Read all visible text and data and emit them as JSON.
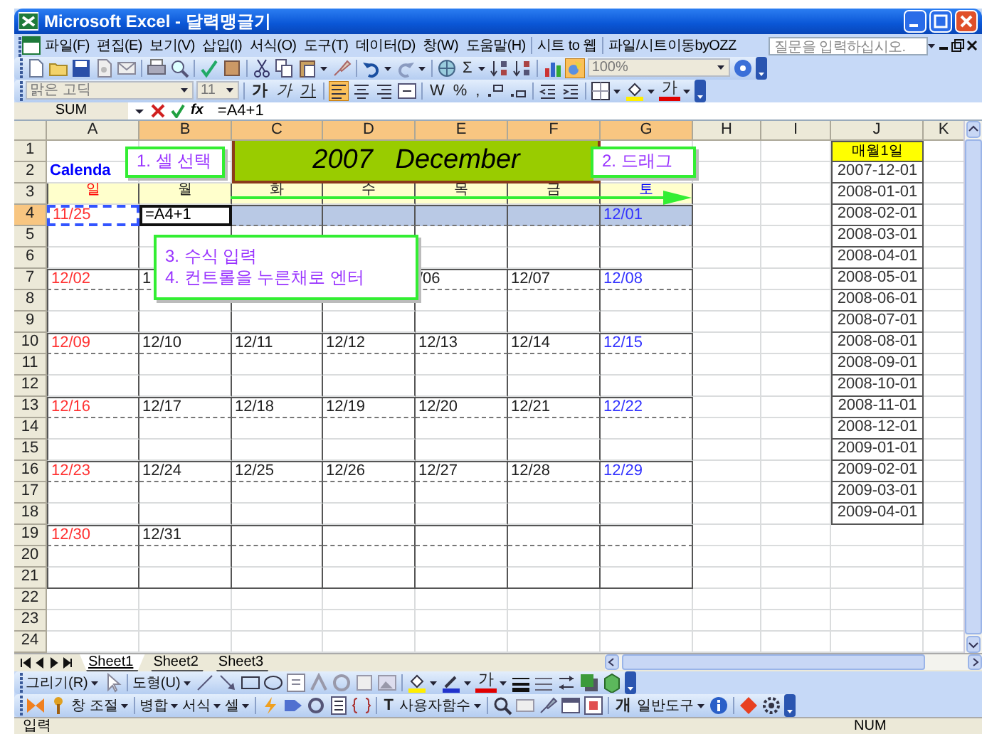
{
  "window": {
    "title": "Microsoft Excel - 달력맹글기"
  },
  "menu": {
    "items": [
      "파일(F)",
      "편집(E)",
      "보기(V)",
      "삽입(I)",
      "서식(O)",
      "도구(T)",
      "데이터(D)",
      "창(W)",
      "도움말(H)"
    ],
    "extras": [
      "시트 to 웹",
      "파일/시트이동byOZZ"
    ],
    "help_placeholder": "질문을 입력하십시오."
  },
  "toolbars": {
    "standard": {
      "sum": "Σ",
      "zoom": "100%"
    },
    "formatting": {
      "font": "맑은 고딕",
      "size": "11",
      "bold": "가",
      "italic": "가",
      "underline": "가",
      "currency": "W",
      "percent": "%",
      "comma": ",",
      "font_color": "가"
    },
    "drawing": {
      "draw_menu": "그리기(R)",
      "shapes_menu": "도형(U)",
      "font_color": "가"
    },
    "custom": {
      "window_menu": "창 조절",
      "merge_menu": "병합",
      "format_menu": "서식",
      "cell_menu": "셀",
      "text_glyph": "T",
      "function_menu": "사용자함수",
      "tool_glyph": "개",
      "tools_menu": "일반도구"
    }
  },
  "formula_bar": {
    "name_box": "SUM",
    "insert_function": "fx",
    "formula": "=A4+1"
  },
  "columns": [
    {
      "label": "A",
      "selected": false
    },
    {
      "label": "B",
      "selected": true
    },
    {
      "label": "C",
      "selected": true
    },
    {
      "label": "D",
      "selected": true
    },
    {
      "label": "E",
      "selected": true
    },
    {
      "label": "F",
      "selected": true
    },
    {
      "label": "G",
      "selected": true
    },
    {
      "label": "H",
      "selected": false
    },
    {
      "label": "I",
      "selected": false
    },
    {
      "label": "J",
      "selected": false
    },
    {
      "label": "K",
      "selected": false
    }
  ],
  "rows": [
    {
      "label": "1",
      "selected": false,
      "cells": {
        "C": {
          "text": "2007   December",
          "kind": "banner"
        },
        "J": {
          "text": "매월1일",
          "kind": "list-header"
        }
      }
    },
    {
      "label": "2",
      "selected": false,
      "cells": {
        "A": {
          "text": "Calenda",
          "kind": "label",
          "color": "#0000ff"
        },
        "J": {
          "text": "2007-12-01",
          "kind": "list"
        }
      }
    },
    {
      "label": "3",
      "selected": false,
      "cells": {
        "A": {
          "text": "일",
          "kind": "weekday",
          "color": "#ff0000"
        },
        "B": {
          "text": "월",
          "kind": "weekday",
          "color": "#222222"
        },
        "C": {
          "text": "화",
          "kind": "weekday",
          "color": "#222222"
        },
        "D": {
          "text": "수",
          "kind": "weekday",
          "color": "#222222"
        },
        "E": {
          "text": "목",
          "kind": "weekday",
          "color": "#222222"
        },
        "F": {
          "text": "금",
          "kind": "weekday",
          "color": "#222222"
        },
        "G": {
          "text": "토",
          "kind": "weekday",
          "color": "#0000ff"
        },
        "J": {
          "text": "2008-01-01",
          "kind": "list"
        }
      }
    },
    {
      "label": "4",
      "selected": true,
      "cells": {
        "A": {
          "text": "11/25",
          "kind": "referenced",
          "color": "#ff3333"
        },
        "B": {
          "text": "=A4+1",
          "kind": "editing"
        },
        "G": {
          "text": "12/01",
          "kind": "date",
          "color": "#3333ff"
        },
        "J": {
          "text": "2008-02-01",
          "kind": "list"
        }
      }
    },
    {
      "label": "5",
      "selected": false,
      "cells": {
        "J": {
          "text": "2008-03-01",
          "kind": "list"
        }
      }
    },
    {
      "label": "6",
      "selected": false,
      "cells": {
        "J": {
          "text": "2008-04-01",
          "kind": "list"
        }
      }
    },
    {
      "label": "7",
      "selected": false,
      "cells": {
        "A": {
          "text": "12/02",
          "kind": "date",
          "color": "#ff3333"
        },
        "B": {
          "text": "1",
          "kind": "date",
          "color": "#222222"
        },
        "E": {
          "text": "/06",
          "kind": "date",
          "color": "#222222"
        },
        "F": {
          "text": "12/07",
          "kind": "date",
          "color": "#222222"
        },
        "G": {
          "text": "12/08",
          "kind": "date",
          "color": "#3333ff"
        },
        "J": {
          "text": "2008-05-01",
          "kind": "list"
        }
      }
    },
    {
      "label": "8",
      "selected": false,
      "cells": {
        "J": {
          "text": "2008-06-01",
          "kind": "list"
        }
      }
    },
    {
      "label": "9",
      "selected": false,
      "cells": {
        "J": {
          "text": "2008-07-01",
          "kind": "list"
        }
      }
    },
    {
      "label": "10",
      "selected": false,
      "cells": {
        "A": {
          "text": "12/09",
          "kind": "date",
          "color": "#ff3333"
        },
        "B": {
          "text": "12/10",
          "kind": "date",
          "color": "#222222"
        },
        "C": {
          "text": "12/11",
          "kind": "date",
          "color": "#222222"
        },
        "D": {
          "text": "12/12",
          "kind": "date",
          "color": "#222222"
        },
        "E": {
          "text": "12/13",
          "kind": "date",
          "color": "#222222"
        },
        "F": {
          "text": "12/14",
          "kind": "date",
          "color": "#222222"
        },
        "G": {
          "text": "12/15",
          "kind": "date",
          "color": "#3333ff"
        },
        "J": {
          "text": "2008-08-01",
          "kind": "list"
        }
      }
    },
    {
      "label": "11",
      "selected": false,
      "cells": {
        "J": {
          "text": "2008-09-01",
          "kind": "list"
        }
      }
    },
    {
      "label": "12",
      "selected": false,
      "cells": {
        "J": {
          "text": "2008-10-01",
          "kind": "list"
        }
      }
    },
    {
      "label": "13",
      "selected": false,
      "cells": {
        "A": {
          "text": "12/16",
          "kind": "date",
          "color": "#ff3333"
        },
        "B": {
          "text": "12/17",
          "kind": "date",
          "color": "#222222"
        },
        "C": {
          "text": "12/18",
          "kind": "date",
          "color": "#222222"
        },
        "D": {
          "text": "12/19",
          "kind": "date",
          "color": "#222222"
        },
        "E": {
          "text": "12/20",
          "kind": "date",
          "color": "#222222"
        },
        "F": {
          "text": "12/21",
          "kind": "date",
          "color": "#222222"
        },
        "G": {
          "text": "12/22",
          "kind": "date",
          "color": "#3333ff"
        },
        "J": {
          "text": "2008-11-01",
          "kind": "list"
        }
      }
    },
    {
      "label": "14",
      "selected": false,
      "cells": {
        "J": {
          "text": "2008-12-01",
          "kind": "list"
        }
      }
    },
    {
      "label": "15",
      "selected": false,
      "cells": {
        "J": {
          "text": "2009-01-01",
          "kind": "list"
        }
      }
    },
    {
      "label": "16",
      "selected": false,
      "cells": {
        "A": {
          "text": "12/23",
          "kind": "date",
          "color": "#ff3333"
        },
        "B": {
          "text": "12/24",
          "kind": "date",
          "color": "#222222"
        },
        "C": {
          "text": "12/25",
          "kind": "date",
          "color": "#222222"
        },
        "D": {
          "text": "12/26",
          "kind": "date",
          "color": "#222222"
        },
        "E": {
          "text": "12/27",
          "kind": "date",
          "color": "#222222"
        },
        "F": {
          "text": "12/28",
          "kind": "date",
          "color": "#222222"
        },
        "G": {
          "text": "12/29",
          "kind": "date",
          "color": "#3333ff"
        },
        "J": {
          "text": "2009-02-01",
          "kind": "list"
        }
      }
    },
    {
      "label": "17",
      "selected": false,
      "cells": {
        "J": {
          "text": "2009-03-01",
          "kind": "list"
        }
      }
    },
    {
      "label": "18",
      "selected": false,
      "cells": {
        "J": {
          "text": "2009-04-01",
          "kind": "list"
        }
      }
    },
    {
      "label": "19",
      "selected": false,
      "cells": {
        "A": {
          "text": "12/30",
          "kind": "date",
          "color": "#ff3333"
        },
        "B": {
          "text": "12/31",
          "kind": "date",
          "color": "#222222"
        }
      }
    },
    {
      "label": "20",
      "selected": false,
      "cells": {}
    },
    {
      "label": "21",
      "selected": false,
      "cells": {}
    },
    {
      "label": "22",
      "selected": false,
      "cells": {}
    },
    {
      "label": "23",
      "selected": false,
      "cells": {}
    },
    {
      "label": "24",
      "selected": false,
      "cells": {}
    }
  ],
  "callouts": [
    {
      "lines": [
        "1. 셀 선택"
      ]
    },
    {
      "lines": [
        "2. 드래그"
      ]
    },
    {
      "lines": [
        "3. 수식 입력",
        "4. 컨트롤을 누른채로 엔터"
      ]
    }
  ],
  "sheet_tabs": [
    {
      "label": "Sheet1",
      "selected": true
    },
    {
      "label": "Sheet2",
      "selected": false
    },
    {
      "label": "Sheet3",
      "selected": false
    }
  ],
  "status_bar": {
    "mode": "입력",
    "indicator": "NUM"
  }
}
